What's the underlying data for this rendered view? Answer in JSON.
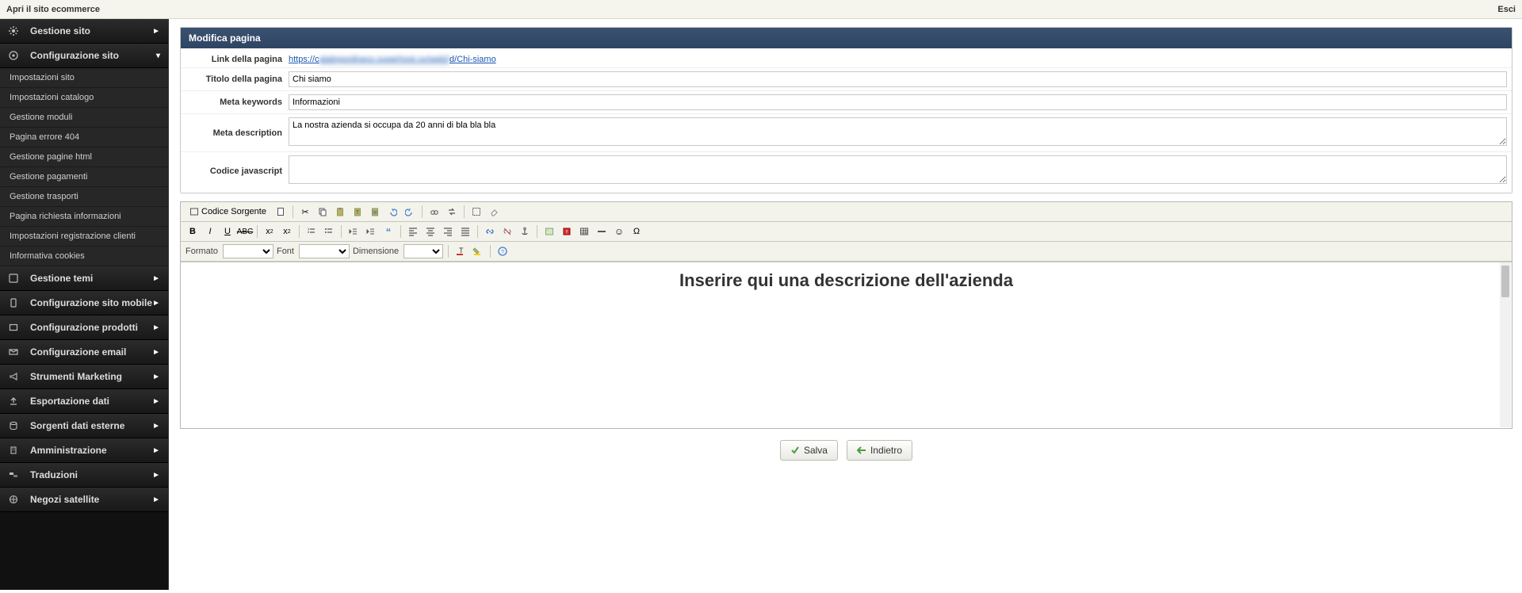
{
  "topbar": {
    "open_site": "Apri il sito ecommerce",
    "logout": "Esci"
  },
  "sidebar": {
    "groups": [
      {
        "label": "Gestione sito",
        "icon": "gear"
      },
      {
        "label": "Configurazione sito",
        "icon": "cog",
        "open": true,
        "items": [
          "Impostazioni sito",
          "Impostazioni catalogo",
          "Gestione moduli",
          "Pagina errore 404",
          "Gestione pagine html",
          "Gestione pagamenti",
          "Gestione trasporti",
          "Pagina richiesta informazioni",
          "Impostazioni registrazione clienti",
          "Informativa cookies"
        ]
      },
      {
        "label": "Gestione temi",
        "icon": "puzzle"
      },
      {
        "label": "Configurazione sito mobile",
        "icon": "mobile"
      },
      {
        "label": "Configurazione prodotti",
        "icon": "box"
      },
      {
        "label": "Configurazione email",
        "icon": "mail"
      },
      {
        "label": "Strumenti Marketing",
        "icon": "megaphone"
      },
      {
        "label": "Esportazione dati",
        "icon": "export"
      },
      {
        "label": "Sorgenti dati esterne",
        "icon": "database"
      },
      {
        "label": "Amministrazione",
        "icon": "building"
      },
      {
        "label": "Traduzioni",
        "icon": "flags"
      },
      {
        "label": "Negozi satellite",
        "icon": "globe"
      }
    ]
  },
  "panel": {
    "title": "Modifica pagina",
    "fields": {
      "link_label": "Link della pagina",
      "link_prefix": "https://c",
      "link_suffix": "d/Chi-siamo",
      "title_label": "Titolo della pagina",
      "title_value": "Chi siamo",
      "meta_keywords_label": "Meta keywords",
      "meta_keywords_value": "Informazioni",
      "meta_description_label": "Meta description",
      "meta_description_value": "La nostra azienda si occupa da 20 anni di bla bla bla",
      "js_label": "Codice javascript",
      "js_value": ""
    }
  },
  "editor": {
    "source_label": "Codice Sorgente",
    "format_label": "Formato",
    "font_label": "Font",
    "size_label": "Dimensione",
    "content_heading": "Inserire qui una descrizione dell'azienda"
  },
  "actions": {
    "save": "Salva",
    "back": "Indietro"
  }
}
